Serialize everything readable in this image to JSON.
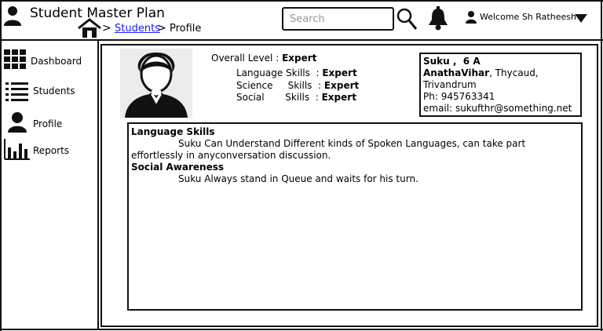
{
  "header": {
    "title": "Student Master Plan",
    "search_placeholder": "Search",
    "welcome": "Welcome Sh Ratheesh"
  },
  "breadcrumb": {
    "sep": ">",
    "students": "Students",
    "profile": "Profile"
  },
  "sidebar": {
    "items": [
      {
        "label": "Dashboard",
        "icon": "grid-icon"
      },
      {
        "label": "Students",
        "icon": "list-icon"
      },
      {
        "label": "Profile",
        "icon": "person-icon"
      },
      {
        "label": "Reports",
        "icon": "bar-chart-icon"
      }
    ]
  },
  "profile": {
    "overall_label": "Overall  Level :",
    "overall_value": "Expert",
    "skills": [
      {
        "label": "Language Skills  :",
        "value": "Expert"
      },
      {
        "label": "Science     Skills  :",
        "value": "Expert"
      },
      {
        "label": "Social       Skills  :",
        "value": "Expert"
      }
    ]
  },
  "address": {
    "name_line": "Suku ,  6 A",
    "street_bold": "AnathaVihar",
    "street_rest": ", Thycaud,",
    "city": "Trivandrum",
    "phone": "Ph: 945763341",
    "email": "email: sukufthr@something.net"
  },
  "notes": [
    {
      "title": "Language Skills",
      "body": "Suku Can Understand Different kinds of Spoken Languages, can take part effortlessly in anyconversation discussion."
    },
    {
      "title": "Social Awareness",
      "body": "Suku Always stand in Queue and waits for his turn."
    }
  ]
}
